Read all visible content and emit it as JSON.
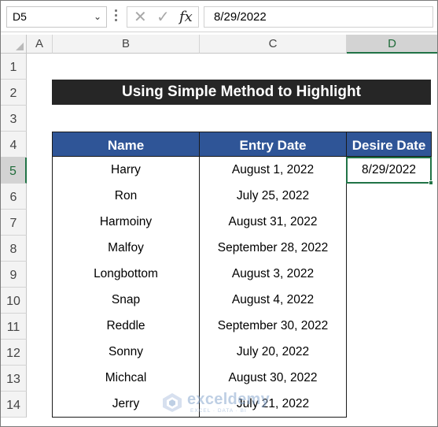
{
  "formula_bar": {
    "name_box": "D5",
    "cancel_icon": "✕",
    "enter_icon": "✓",
    "fx_label": "fx",
    "formula": "8/29/2022"
  },
  "columns": [
    "A",
    "B",
    "C",
    "D"
  ],
  "selected_column": "D",
  "rows": [
    "1",
    "2",
    "3",
    "4",
    "5",
    "6",
    "7",
    "8",
    "9",
    "10",
    "11",
    "12",
    "13",
    "14"
  ],
  "selected_row": "5",
  "title": "Using Simple Method to Highlight",
  "table": {
    "headers": [
      "Name",
      "Entry Date",
      "Desire Date"
    ],
    "rows": [
      {
        "name": "Harry",
        "entry_date": "August 1, 2022"
      },
      {
        "name": "Ron",
        "entry_date": "July 25, 2022"
      },
      {
        "name": "Harmoiny",
        "entry_date": "August 31, 2022"
      },
      {
        "name": "Malfoy",
        "entry_date": "September 28, 2022"
      },
      {
        "name": "Longbottom",
        "entry_date": "August 3, 2022"
      },
      {
        "name": "Snap",
        "entry_date": "August 4, 2022"
      },
      {
        "name": "Reddle",
        "entry_date": "September 30, 2022"
      },
      {
        "name": "Sonny",
        "entry_date": "July 20, 2022"
      },
      {
        "name": "Michcal",
        "entry_date": "August 30, 2022"
      },
      {
        "name": "Jerry",
        "entry_date": "July 21, 2022"
      }
    ],
    "desire_date": "8/29/2022"
  },
  "watermark": {
    "brand": "exceldemy",
    "tagline": "EXCEL · DATA · BI"
  },
  "colors": {
    "header_fill": "#2f5597",
    "title_fill": "#262626",
    "selection": "#217346"
  }
}
